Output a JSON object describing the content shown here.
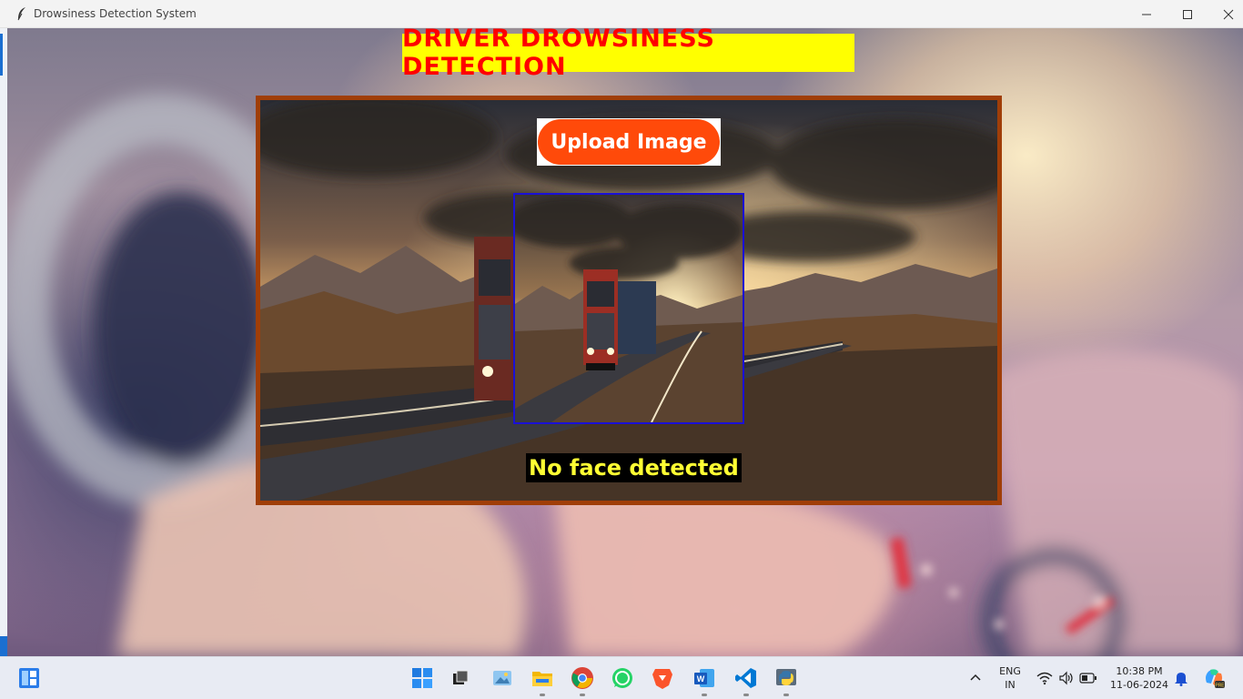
{
  "window": {
    "title": "Drowsiness Detection System"
  },
  "app": {
    "heading": "DRIVER DROWSINESS DETECTION",
    "upload_label": "Upload Image",
    "status_text": "No face detected",
    "colors": {
      "heading_bg": "#ffff00",
      "heading_text": "#ff0000",
      "panel_border": "#a03e08",
      "upload_bg": "#ff4a0a",
      "preview_border": "#1a10d6",
      "status_bg": "#000000",
      "status_text": "#ffff33"
    }
  },
  "taskbar": {
    "apps": [
      "start-icon",
      "widgets-icon",
      "task-view-icon",
      "photos-icon",
      "file-explorer-icon",
      "chrome-icon",
      "whatsapp-icon",
      "brave-icon",
      "word-icon",
      "vscode-icon",
      "python-icon"
    ],
    "tray": {
      "lang_line1": "ENG",
      "lang_line2": "IN",
      "time": "10:38 PM",
      "date": "11-06-2024"
    }
  }
}
